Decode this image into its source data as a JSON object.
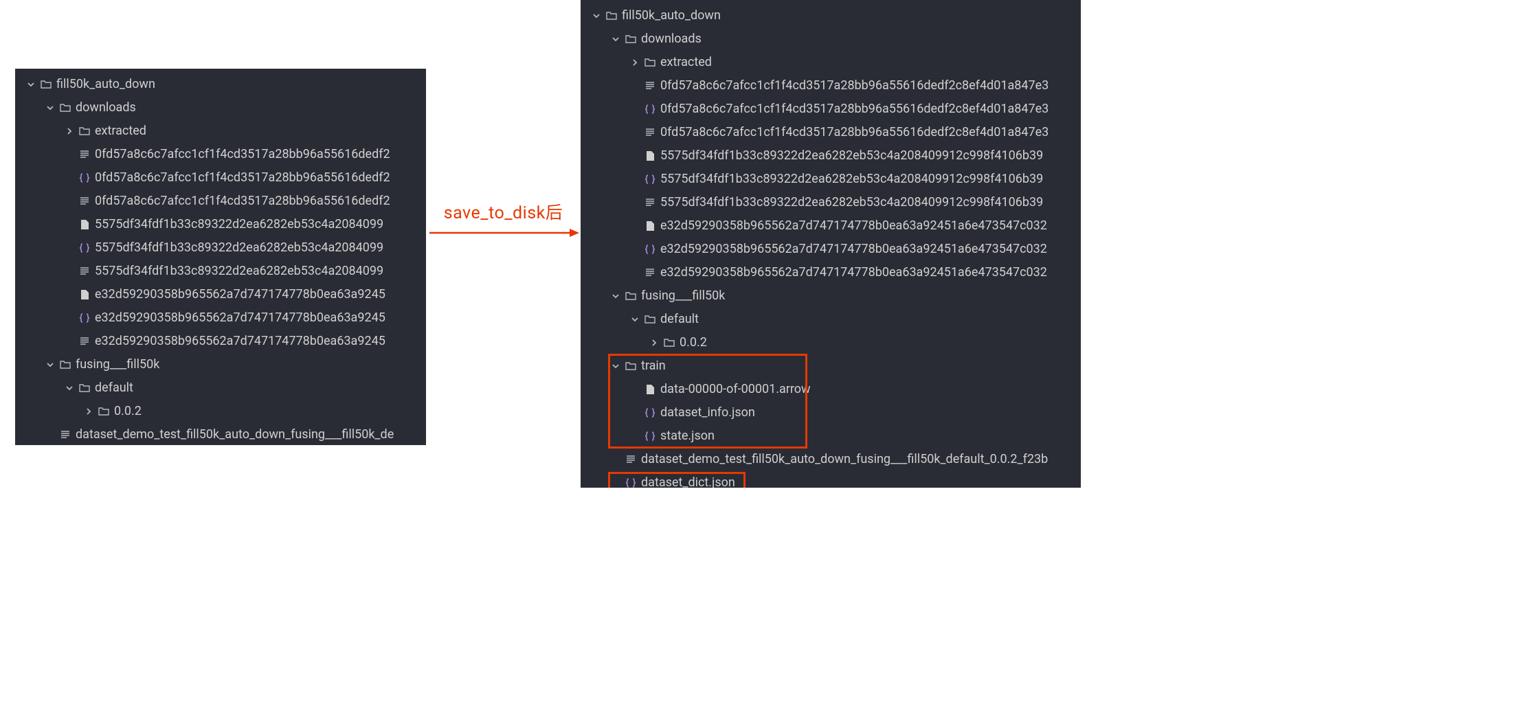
{
  "middle_label": "save_to_disk后",
  "left_tree": {
    "root": "fill50k_auto_down",
    "downloads": "downloads",
    "extracted": "extracted",
    "files": [
      {
        "type": "lines",
        "name": "0fd57a8c6c7afcc1cf1f4cd3517a28bb96a55616dedf2"
      },
      {
        "type": "json",
        "name": "0fd57a8c6c7afcc1cf1f4cd3517a28bb96a55616dedf2"
      },
      {
        "type": "lines",
        "name": "0fd57a8c6c7afcc1cf1f4cd3517a28bb96a55616dedf2"
      },
      {
        "type": "file",
        "name": "5575df34fdf1b33c89322d2ea6282eb53c4a2084099"
      },
      {
        "type": "json",
        "name": "5575df34fdf1b33c89322d2ea6282eb53c4a2084099"
      },
      {
        "type": "lines",
        "name": "5575df34fdf1b33c89322d2ea6282eb53c4a2084099"
      },
      {
        "type": "file",
        "name": "e32d59290358b965562a7d747174778b0ea63a9245"
      },
      {
        "type": "json",
        "name": "e32d59290358b965562a7d747174778b0ea63a9245"
      },
      {
        "type": "lines",
        "name": "e32d59290358b965562a7d747174778b0ea63a9245"
      }
    ],
    "fusing": "fusing___fill50k",
    "default_dir": "default",
    "version_dir": "0.0.2",
    "demo_file": "dataset_demo_test_fill50k_auto_down_fusing___fill50k_de"
  },
  "right_tree": {
    "root": "fill50k_auto_down",
    "downloads": "downloads",
    "extracted": "extracted",
    "files": [
      {
        "type": "lines",
        "name": "0fd57a8c6c7afcc1cf1f4cd3517a28bb96a55616dedf2c8ef4d01a847e3"
      },
      {
        "type": "json",
        "name": "0fd57a8c6c7afcc1cf1f4cd3517a28bb96a55616dedf2c8ef4d01a847e3"
      },
      {
        "type": "lines",
        "name": "0fd57a8c6c7afcc1cf1f4cd3517a28bb96a55616dedf2c8ef4d01a847e3"
      },
      {
        "type": "file",
        "name": "5575df34fdf1b33c89322d2ea6282eb53c4a208409912c998f4106b39"
      },
      {
        "type": "json",
        "name": "5575df34fdf1b33c89322d2ea6282eb53c4a208409912c998f4106b39"
      },
      {
        "type": "lines",
        "name": "5575df34fdf1b33c89322d2ea6282eb53c4a208409912c998f4106b39"
      },
      {
        "type": "file",
        "name": "e32d59290358b965562a7d747174778b0ea63a92451a6e473547c032"
      },
      {
        "type": "json",
        "name": "e32d59290358b965562a7d747174778b0ea63a92451a6e473547c032"
      },
      {
        "type": "lines",
        "name": "e32d59290358b965562a7d747174778b0ea63a92451a6e473547c032"
      }
    ],
    "fusing": "fusing___fill50k",
    "default_dir": "default",
    "version_dir": "0.0.2",
    "train_dir": "train",
    "train_files": [
      {
        "type": "file",
        "name": "data-00000-of-00001.arrow"
      },
      {
        "type": "json",
        "name": "dataset_info.json"
      },
      {
        "type": "json",
        "name": "state.json"
      }
    ],
    "demo_file": "dataset_demo_test_fill50k_auto_down_fusing___fill50k_default_0.0.2_f23b",
    "dict_file": "dataset_dict.json"
  }
}
